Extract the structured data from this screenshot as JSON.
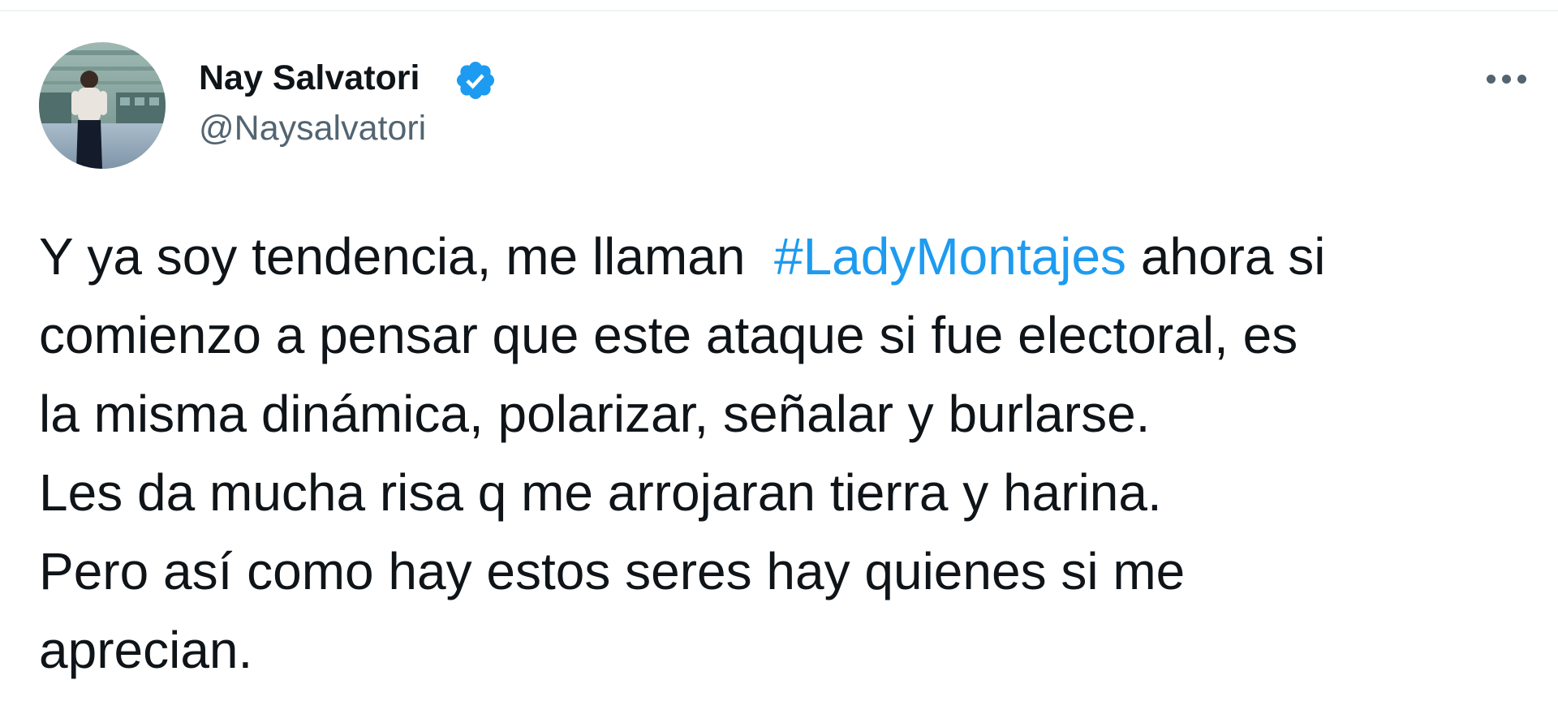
{
  "tweet": {
    "author": {
      "name": "Nay Salvatori",
      "handle": "@Naysalvatori",
      "verified": true,
      "avatar_icon": "profile-photo"
    },
    "more_icon": "ellipsis-icon",
    "text_lines": [
      {
        "before": "Y ya soy tendencia, me llaman  ",
        "hashtag": "#LadyMontajes",
        "after": " ahora si"
      },
      {
        "text": "comienzo a pensar que este ataque si fue electoral, es"
      },
      {
        "text": "la misma dinámica, polarizar, señalar y burlarse."
      },
      {
        "text": "Les da mucha risa q me arrojaran tierra y harina."
      },
      {
        "text": "Pero así como hay estos seres hay quienes si me"
      },
      {
        "text": "aprecian."
      }
    ]
  },
  "colors": {
    "text_primary": "#0f1419",
    "text_secondary": "#536471",
    "hashtag": "#1d9bf0",
    "verified_badge": "#1d9bf0"
  }
}
